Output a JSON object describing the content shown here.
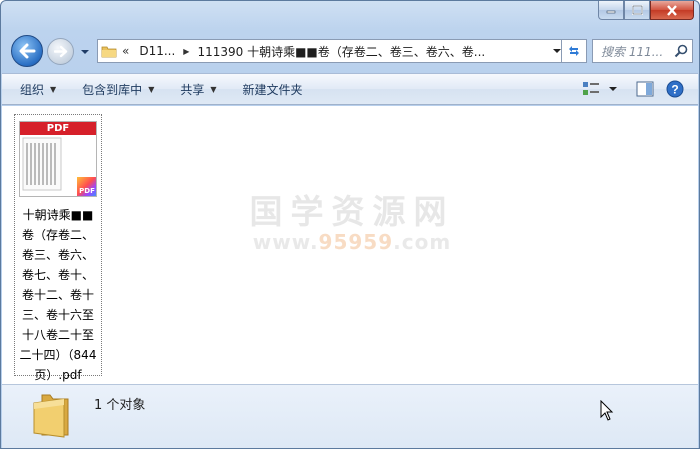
{
  "address": {
    "overflow_chevron": "«",
    "segments": [
      "D11...",
      "111390 十朝诗乘■■卷（存卷二、卷三、卷六、卷..."
    ]
  },
  "search": {
    "placeholder": "搜索 111..."
  },
  "toolbar": {
    "organize": "组织",
    "include_in_library": "包含到库中",
    "share": "共享",
    "new_folder": "新建文件夹"
  },
  "file": {
    "thumb_band": "PDF",
    "badge": "PDF",
    "name": "十朝诗乘■■卷（存卷二、卷三、卷六、卷七、卷十、卷十二、卷十三、卷十六至十八卷二十至二十四）（844页）.pdf"
  },
  "watermark": {
    "title": "国学资源网",
    "url_prefix": "www.",
    "url_number": "95959",
    "url_suffix": ".com"
  },
  "status": {
    "count_text": "1 个对象"
  },
  "colors": {
    "pdf_red": "#d6202a",
    "window_blue": "#bcd3ee"
  }
}
